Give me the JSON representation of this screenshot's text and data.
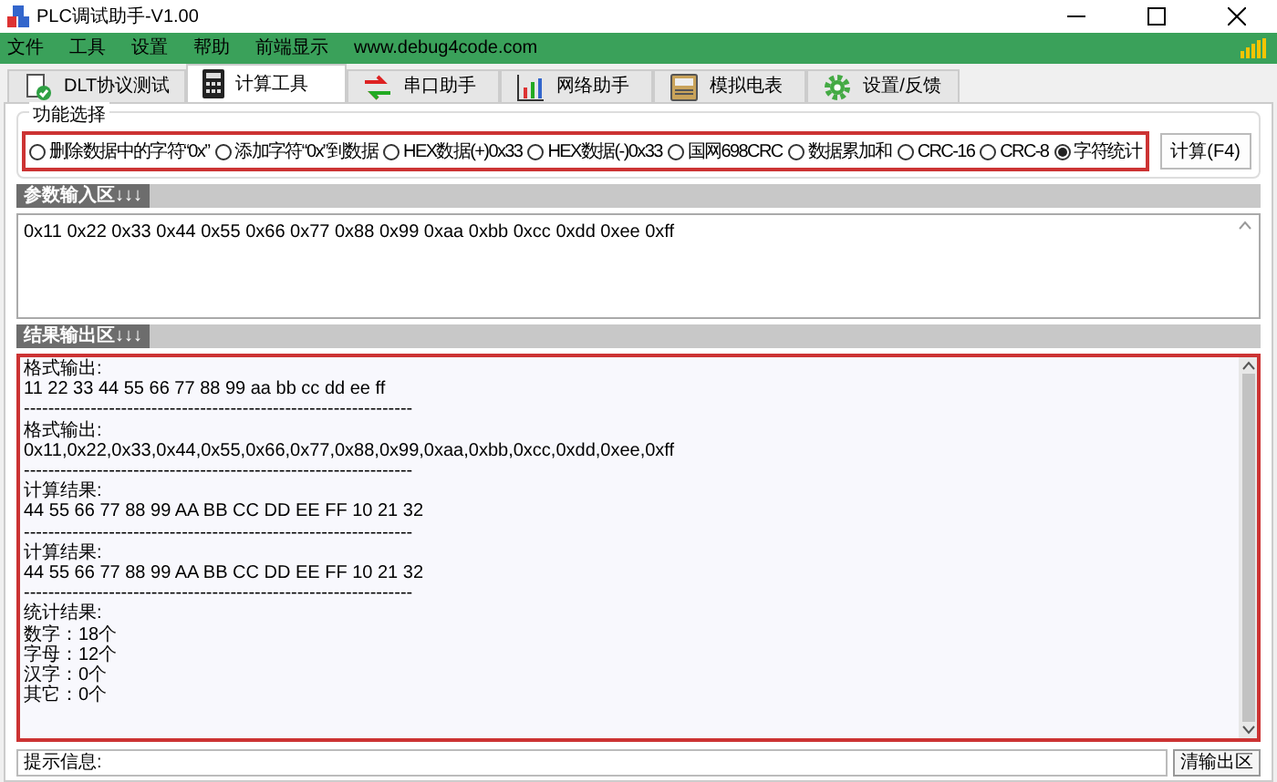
{
  "window": {
    "title": "PLC调试助手-V1.00"
  },
  "menu": [
    "文件",
    "工具",
    "设置",
    "帮助",
    "前端显示",
    "www.debug4code.com"
  ],
  "tabs": [
    {
      "label": "DLT协议测试",
      "selected": false,
      "kind": "check"
    },
    {
      "label": "计算工具",
      "selected": true,
      "kind": "calculator"
    },
    {
      "label": "串口助手",
      "selected": false,
      "kind": "arrows"
    },
    {
      "label": "网络助手",
      "selected": false,
      "kind": "chart"
    },
    {
      "label": "模拟电表",
      "selected": false,
      "kind": "meter"
    },
    {
      "label": "设置/反馈",
      "selected": false,
      "kind": "gear"
    }
  ],
  "function_group": {
    "title": "功能选择",
    "options": [
      {
        "label": "删除数据中的字符“0x”",
        "selected": false
      },
      {
        "label": "添加字符“0x”到数据",
        "selected": false
      },
      {
        "label": "HEX数据(+)0x33",
        "selected": false
      },
      {
        "label": "HEX数据(-)0x33",
        "selected": false
      },
      {
        "label": "国网698CRC",
        "selected": false
      },
      {
        "label": "数据累加和",
        "selected": false
      },
      {
        "label": "CRC-16",
        "selected": false
      },
      {
        "label": "CRC-8",
        "selected": false
      },
      {
        "label": "字符统计",
        "selected": true
      }
    ],
    "button": "计算(F4)"
  },
  "input": {
    "header": "参数输入区↓↓↓",
    "value": "0x11 0x22 0x33 0x44 0x55 0x66 0x77 0x88 0x99 0xaa 0xbb 0xcc 0xdd 0xee 0xff"
  },
  "output": {
    "header": "结果输出区↓↓↓",
    "lines": [
      "格式输出:",
      "11 22 33 44 55 66 77 88 99 aa bb cc dd ee ff",
      "----------------------------------------------------------------",
      "格式输出:",
      "0x11,0x22,0x33,0x44,0x55,0x66,0x77,0x88,0x99,0xaa,0xbb,0xcc,0xdd,0xee,0xff",
      "----------------------------------------------------------------",
      "计算结果:",
      "44 55 66 77 88 99 AA BB CC DD EE FF 10 21 32",
      "----------------------------------------------------------------",
      "计算结果:",
      "44 55 66 77 88 99 AA BB CC DD EE FF 10 21 32",
      "----------------------------------------------------------------",
      "统计结果:",
      "数字：18个",
      "字母：12个",
      "汉字：0个",
      "其它：0个"
    ]
  },
  "status": {
    "label": "提示信息:",
    "button": "清输出区"
  }
}
